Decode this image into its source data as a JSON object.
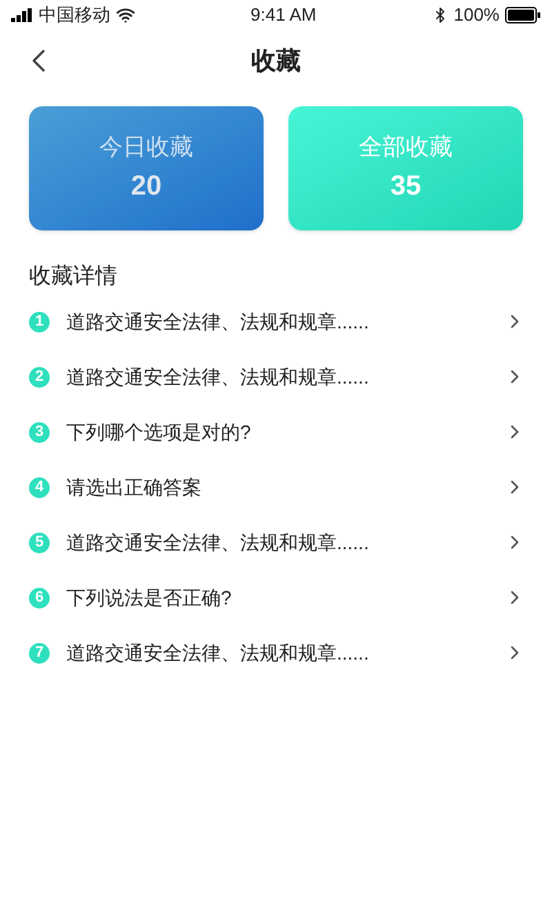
{
  "status_bar": {
    "carrier": "中国移动",
    "time": "9:41 AM",
    "battery": "100%"
  },
  "header": {
    "title": "收藏"
  },
  "stats": [
    {
      "kind": "today",
      "label": "今日收藏",
      "value": "20"
    },
    {
      "kind": "all",
      "label": "全部收藏",
      "value": "35"
    }
  ],
  "section_title": "收藏详情",
  "items": [
    {
      "number": "1",
      "text": "道路交通安全法律、法规和规章......"
    },
    {
      "number": "2",
      "text": "道路交通安全法律、法规和规章......"
    },
    {
      "number": "3",
      "text": "下列哪个选项是对的?"
    },
    {
      "number": "4",
      "text": "请选出正确答案"
    },
    {
      "number": "5",
      "text": "道路交通安全法律、法规和规章......"
    },
    {
      "number": "6",
      "text": "下列说法是否正确?"
    },
    {
      "number": "7",
      "text": "道路交通安全法律、法规和规章......"
    }
  ]
}
